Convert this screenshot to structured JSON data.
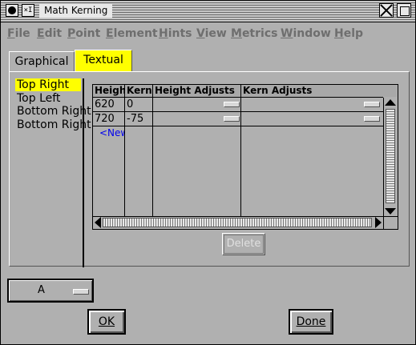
{
  "window": {
    "title": "Math Kerning",
    "minimize_glyph": "×I"
  },
  "menubar": [
    "File",
    "Edit",
    "Point",
    "Element",
    "Hints",
    "View",
    "Metrics",
    "Window",
    "Help"
  ],
  "tabs": [
    {
      "label": "Graphical",
      "selected": false
    },
    {
      "label": "Textual",
      "selected": true
    }
  ],
  "corners": [
    {
      "label": "Top Right",
      "selected": true
    },
    {
      "label": "Top Left",
      "selected": false
    },
    {
      "label": "Bottom Right",
      "selected": false
    },
    {
      "label": "Bottom Right",
      "selected": false
    }
  ],
  "grid": {
    "columns": [
      "Height",
      "Kern",
      "Height Adjusts",
      "Kern Adjusts"
    ],
    "rows": [
      {
        "height": "620",
        "kern": "0"
      },
      {
        "height": "720",
        "kern": "-75"
      }
    ],
    "new_row_label": "<New>"
  },
  "buttons": {
    "delete": "Delete",
    "ok": "OK",
    "done": "Done"
  },
  "glyph_popup": {
    "value": "A"
  },
  "colors": {
    "selection": "#ffff00",
    "background": "#b0b0b0",
    "new_row_link": "#0000ee"
  }
}
